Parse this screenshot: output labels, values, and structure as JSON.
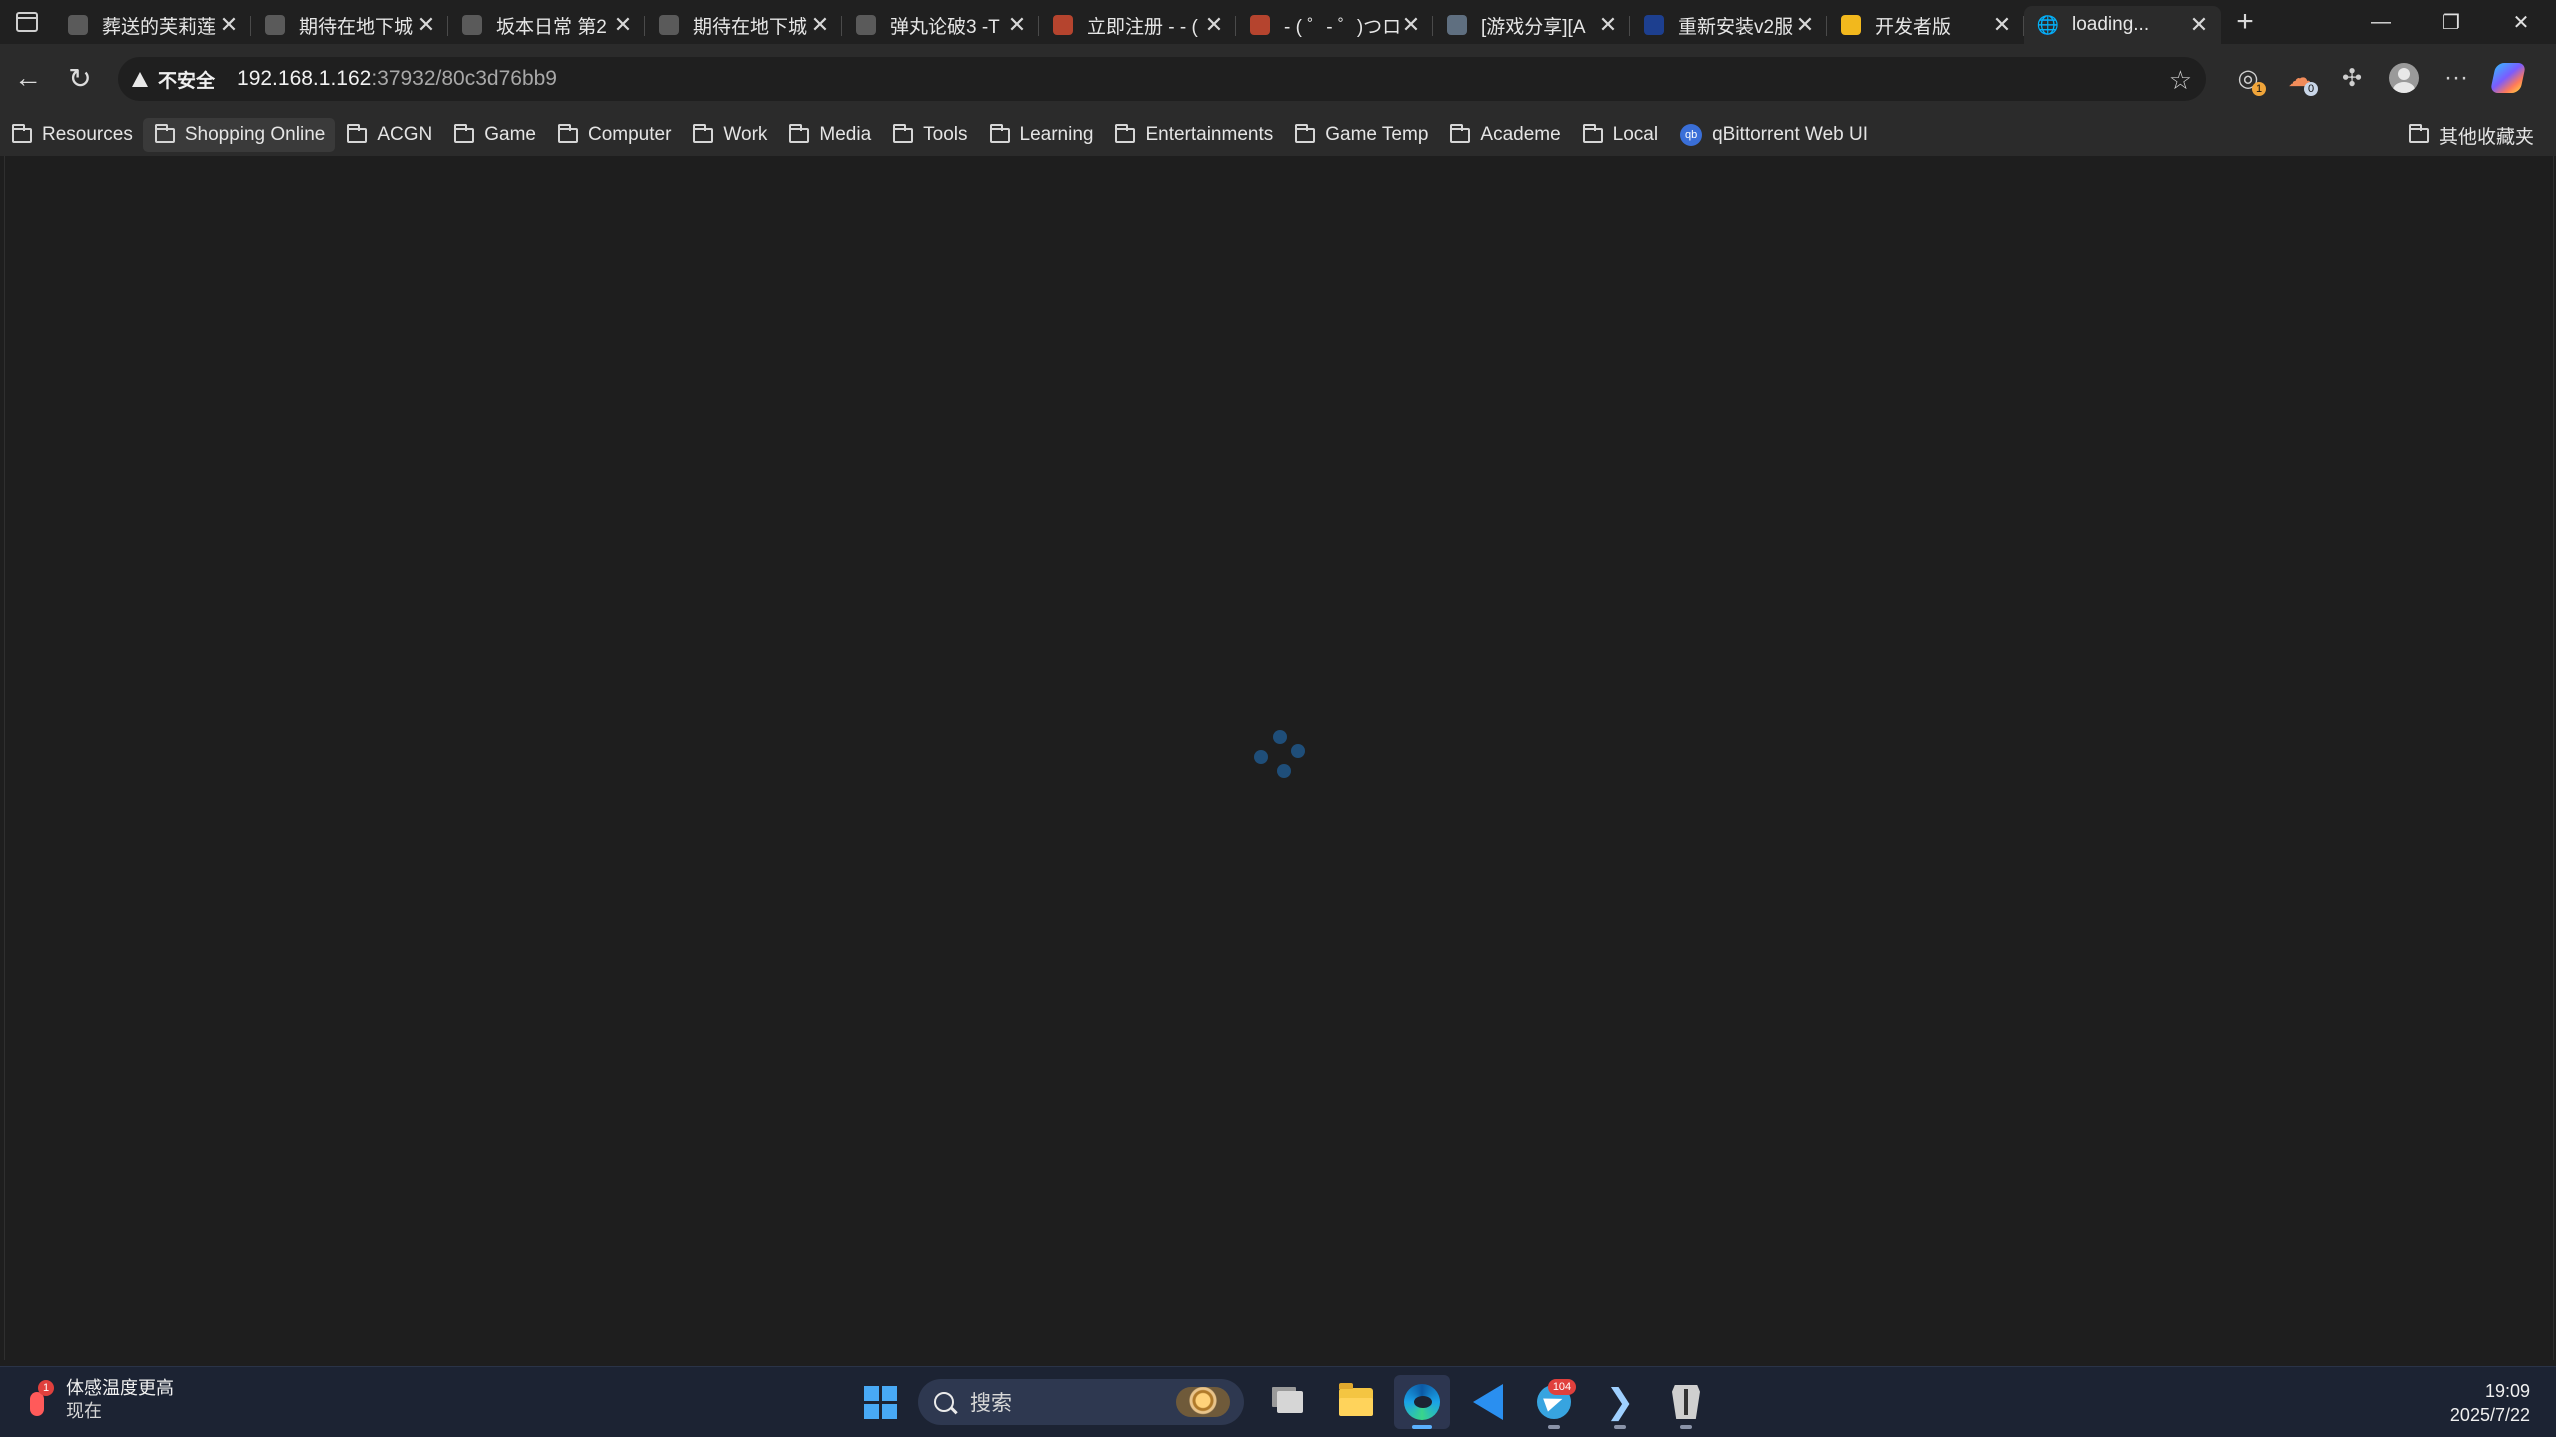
{
  "browser": {
    "tabs": [
      {
        "title": "葬送的芙莉莲",
        "favicon": "anime-avatar-icon",
        "favicon_color": "#5a5a5a"
      },
      {
        "title": "期待在地下城",
        "favicon": "anime-avatar-icon",
        "favicon_color": "#5a5a5a"
      },
      {
        "title": "坂本日常 第2",
        "favicon": "anime-avatar-icon",
        "favicon_color": "#5a5a5a"
      },
      {
        "title": "期待在地下城",
        "favicon": "anime-avatar-icon",
        "favicon_color": "#5a5a5a"
      },
      {
        "title": "弹丸论破3 -T",
        "favicon": "anime-avatar-icon",
        "favicon_color": "#5a5a5a"
      },
      {
        "title": "立即注册 - - (",
        "favicon": "red-site-icon",
        "favicon_color": "#b5442e"
      },
      {
        "title": "- ( ゜- ゜)つロ",
        "favicon": "red-site-icon",
        "favicon_color": "#b5442e"
      },
      {
        "title": "[游戏分享][A",
        "favicon": "gray-thumbnail-icon",
        "favicon_color": "#5f6f80"
      },
      {
        "title": "重新安装v2服",
        "favicon": "fs-logo-icon",
        "favicon_color": "#1d3f8f"
      },
      {
        "title": "开发者版",
        "favicon": "dev-logo-icon",
        "favicon_color": "#f2b81d"
      },
      {
        "title": "loading...",
        "favicon": "globe-icon",
        "favicon_color": "#2b2b2b",
        "active": true
      }
    ],
    "close_glyph": "✕",
    "new_tab_glyph": "+",
    "window_controls": {
      "minimize": "—",
      "restore": "❐",
      "close": "✕"
    },
    "address": {
      "security_label": "不安全",
      "url_host": "192.168.1.162",
      "url_path": ":37932/80c3d76bb9"
    },
    "toolbar_badges": {
      "ext1": "1",
      "ext2": "0"
    },
    "bookmarks": [
      {
        "label": "Resources",
        "type": "folder"
      },
      {
        "label": "Shopping Online",
        "type": "folder"
      },
      {
        "label": "ACGN",
        "type": "folder"
      },
      {
        "label": "Game",
        "type": "folder"
      },
      {
        "label": "Computer",
        "type": "folder"
      },
      {
        "label": "Work",
        "type": "folder"
      },
      {
        "label": "Media",
        "type": "folder"
      },
      {
        "label": "Tools",
        "type": "folder"
      },
      {
        "label": "Learning",
        "type": "folder"
      },
      {
        "label": "Entertainments",
        "type": "folder"
      },
      {
        "label": "Game Temp",
        "type": "folder"
      },
      {
        "label": "Academe",
        "type": "folder"
      },
      {
        "label": "Local",
        "type": "folder"
      },
      {
        "label": "qBittorrent  Web UI",
        "type": "link"
      }
    ],
    "other_bookmarks": "其他收藏夹",
    "qb_glyph": "qb"
  },
  "page": {
    "state": "loading-spinner",
    "spinner_color": "#1f4e79"
  },
  "taskbar": {
    "weather": {
      "badge": "1",
      "line1": "体感温度更高",
      "line2": "现在"
    },
    "search_placeholder": "搜索",
    "telegram_badge": "104",
    "clock": {
      "time": "19:09",
      "date": "2025/7/22"
    }
  }
}
